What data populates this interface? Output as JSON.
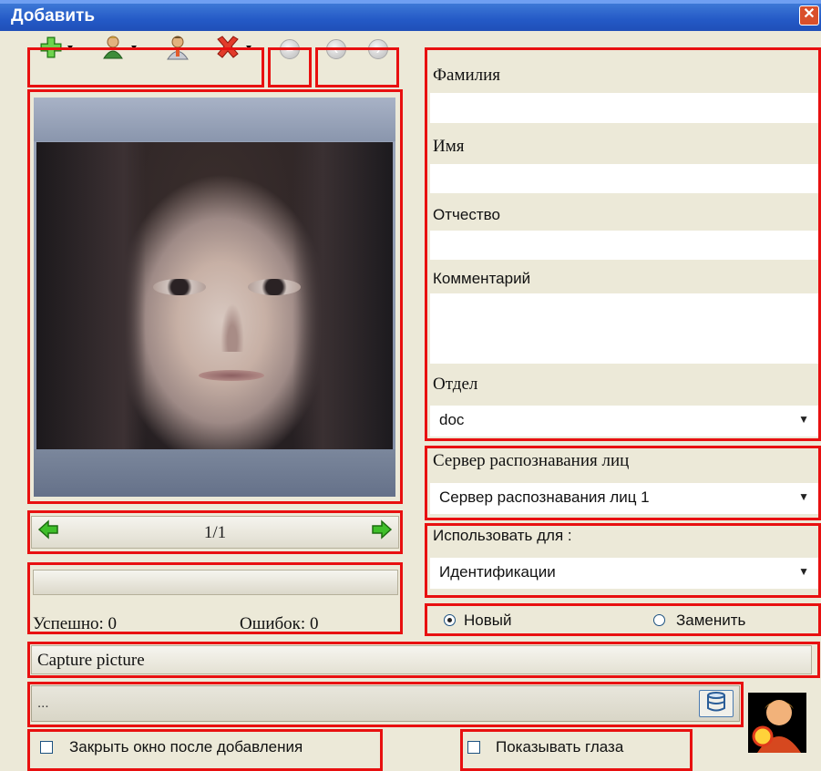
{
  "window": {
    "title": "Добавить",
    "close_glyph": "✕"
  },
  "toolbar": {
    "icons": [
      "add-icon",
      "user-menu-icon",
      "user-icon",
      "delete-icon",
      "minus-icon",
      "back-icon",
      "forward-icon"
    ]
  },
  "photo_nav": {
    "counter": "1/1"
  },
  "stats": {
    "success": "Успешно: 0",
    "errors": "Ошибок: 0"
  },
  "form": {
    "last_name_label": "Фамилия",
    "last_name_value": "",
    "first_name_label": "Имя",
    "first_name_value": "",
    "middle_name_label": "Отчество",
    "middle_name_value": "",
    "comment_label": "Комментарий",
    "comment_value": "",
    "department_label": "Отдел",
    "department_value": "doc",
    "server_label": "Сервер распознавания лиц",
    "server_value": "Сервер распознавания лиц 1",
    "use_for_label": "Использовать для :",
    "use_for_value": "Идентификации",
    "mode_new_label": "Новый",
    "mode_replace_label": "Заменить",
    "mode_selected": "Новый"
  },
  "capture": {
    "label": "Capture picture",
    "path_value": "..."
  },
  "options": {
    "close_after_add_label": "Закрыть окно после добавления",
    "close_after_add_checked": false,
    "show_eyes_label": "Показывать глаза",
    "show_eyes_checked": false
  },
  "colors": {
    "highlight_border": "#e81010",
    "window_bg": "#ece9d8",
    "titlebar": "#2459c6"
  }
}
